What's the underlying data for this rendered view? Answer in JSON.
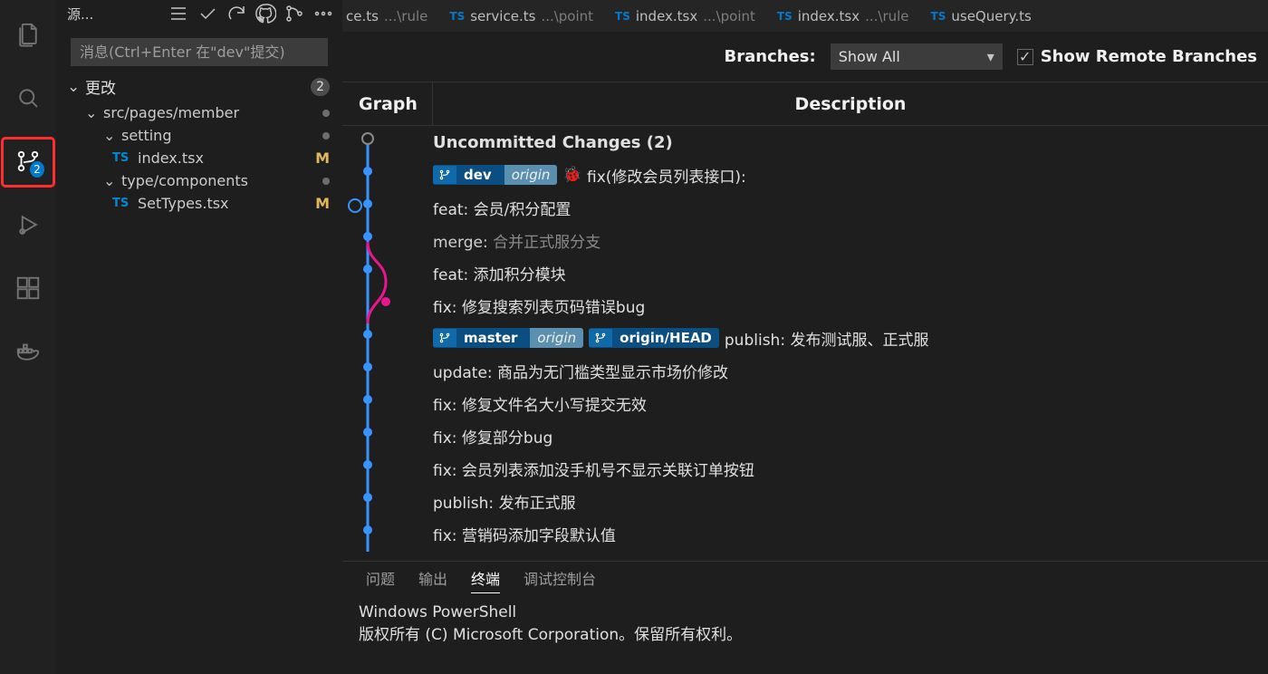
{
  "sideHeader": {
    "title": "源..."
  },
  "commitBox": {
    "placeholder": "消息(Ctrl+Enter 在\"dev\"提交)"
  },
  "scm": {
    "sectionLabel": "更改",
    "count": "2",
    "folder1": "src/pages/member",
    "sub1": "setting",
    "file1": "index.tsx",
    "file1Status": "M",
    "sub2": "type/components",
    "file2": "SetTypes.tsx",
    "file2Status": "M"
  },
  "tabs": [
    {
      "name": "ce.ts",
      "hint": "...\\rule"
    },
    {
      "name": "service.ts",
      "hint": "...\\point"
    },
    {
      "name": "index.tsx",
      "hint": "...\\point"
    },
    {
      "name": "index.tsx",
      "hint": "...\\rule"
    },
    {
      "name": "useQuery.ts",
      "hint": ""
    }
  ],
  "branchBar": {
    "branchesLabel": "Branches:",
    "selectValue": "Show All",
    "checkboxLabel": "Show Remote Branches"
  },
  "graphHeader": {
    "graph": "Graph",
    "desc": "Description"
  },
  "scmBadge": "2",
  "commits": {
    "uncommitted": "Uncommitted Changes (2)",
    "row2": {
      "ref": "dev",
      "remote": "origin",
      "msg": "fix(修改会员列表接口):"
    },
    "row3": "feat: 会员/积分配置",
    "row4_label": "merge: ",
    "row4_msg": "合并正式服分支",
    "row5": "feat: 添加积分模块",
    "row6": "fix: 修复搜索列表页码错误bug",
    "row7": {
      "ref1": "master",
      "remote1": "origin",
      "ref2": "origin/HEAD",
      "msg": "publish: 发布测试服、正式服"
    },
    "row8": "update: 商品为无门槛类型显示市场价修改",
    "row9": "fix: 修复文件名大小写提交无效",
    "row10": "fix: 修复部分bug",
    "row11": "fix: 会员列表添加没手机号不显示关联订单按钮",
    "row12": "publish: 发布正式服",
    "row13": "fix: 营销码添加字段默认值"
  },
  "panelTabs": {
    "problems": "问题",
    "output": "输出",
    "terminal": "终端",
    "debug": "调试控制台"
  },
  "terminal": {
    "line1": "Windows PowerShell",
    "line2": "版权所有 (C) Microsoft Corporation。保留所有权利。"
  }
}
